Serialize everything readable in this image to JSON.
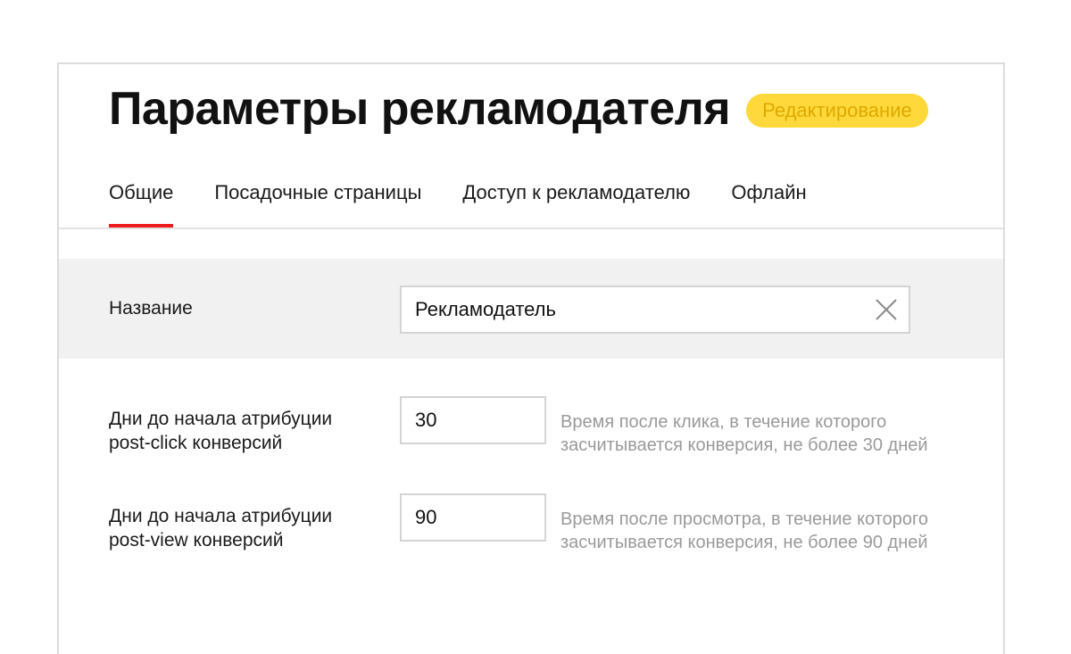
{
  "header": {
    "title": "Параметры рекламодателя",
    "status_badge": "Редактирование"
  },
  "tabs": [
    {
      "label": "Общие",
      "active": true
    },
    {
      "label": "Посадочные страницы",
      "active": false
    },
    {
      "label": "Доступ к рекламодателю",
      "active": false
    },
    {
      "label": "Офлайн",
      "active": false
    }
  ],
  "form": {
    "name": {
      "label": "Название",
      "value": "Рекламодатель"
    },
    "post_click": {
      "label_line1": "Дни до начала атрибуции",
      "label_line2": "post-click конверсий",
      "value": "30",
      "hint_line1": "Время после клика, в течение которого",
      "hint_line2": "засчитывается конверсия, не более 30 дней"
    },
    "post_view": {
      "label_line1": "Дни до начала атрибуции",
      "label_line2": "post-view конверсий",
      "value": "90",
      "hint_line1": "Время после просмотра, в течение которого",
      "hint_line2": "засчитывается конверсия, не более 90 дней"
    }
  },
  "colors": {
    "accent_tab": "#ee1c1c",
    "badge_bg": "#ffd93b",
    "badge_text": "#e0a800",
    "hint_text": "#9a9a9a",
    "name_row_bg": "#f1f1f2"
  },
  "icons": {
    "clear": "close-icon"
  }
}
